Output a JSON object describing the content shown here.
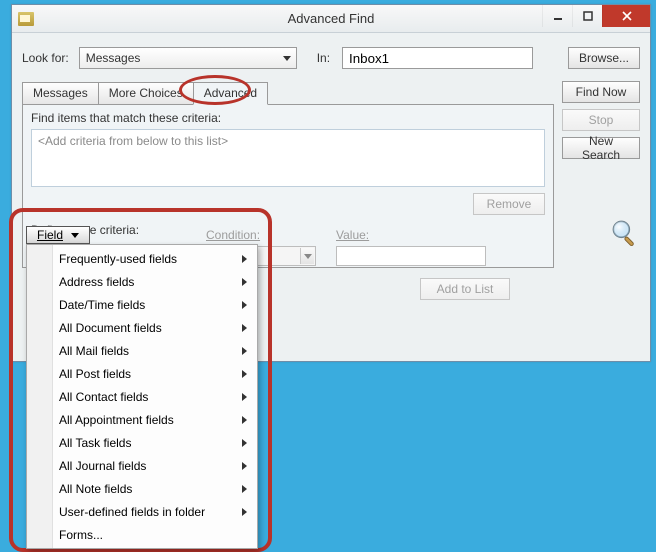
{
  "title": "Advanced Find",
  "row1": {
    "look_for_label": "Look for:",
    "look_for_value": "Messages",
    "in_label": "In:",
    "in_value": "Inbox1",
    "browse": "Browse..."
  },
  "tabs": {
    "messages": "Messages",
    "more_choices": "More Choices",
    "advanced": "Advanced"
  },
  "panel": {
    "heading": "Find items that match these criteria:",
    "placeholder_text": "<Add criteria from below to this list>",
    "remove": "Remove",
    "define_label": "Define more criteria:"
  },
  "right": {
    "find_now": "Find Now",
    "stop": "Stop",
    "new_search": "New Search"
  },
  "criteria": {
    "field_btn": "Field",
    "condition_label": "Condition:",
    "value_label": "Value:",
    "add_to_list": "Add to List"
  },
  "menu_items": {
    "freq": "Frequently-used fields",
    "address": "Address fields",
    "datetime": "Date/Time fields",
    "document": "All Document fields",
    "mail": "All Mail fields",
    "post": "All Post fields",
    "contact": "All Contact fields",
    "appointment": "All Appointment fields",
    "task": "All Task fields",
    "journal": "All Journal fields",
    "note": "All Note fields",
    "user": "User-defined fields in folder",
    "forms": "Forms..."
  }
}
